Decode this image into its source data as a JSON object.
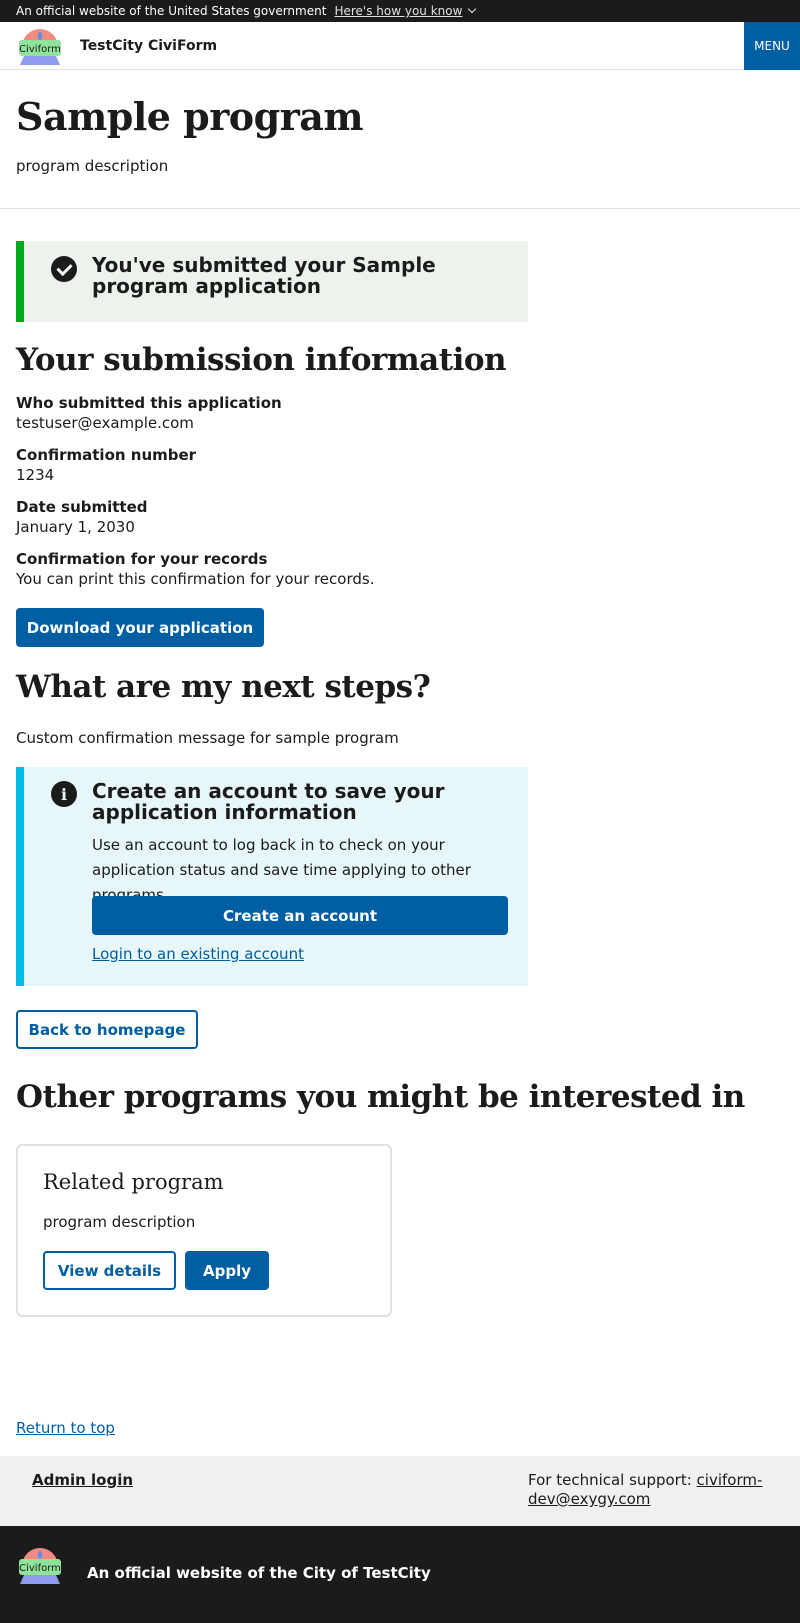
{
  "gov_banner": {
    "text": "An official website of the United States government",
    "link": "Here's how you know"
  },
  "header": {
    "logo_text": "Civiform",
    "site_name": "TestCity CiviForm",
    "menu": "MENU"
  },
  "hero": {
    "title": "Sample program",
    "description": "program description"
  },
  "success_alert": {
    "title": "You've submitted your Sample program application"
  },
  "submission": {
    "heading": "Your submission information",
    "fields": [
      {
        "label": "Who submitted this application",
        "value": "testuser@example.com"
      },
      {
        "label": "Confirmation number",
        "value": "1234"
      },
      {
        "label": "Date submitted",
        "value": "January 1, 2030"
      },
      {
        "label": "Confirmation for your records",
        "value": "You can print this confirmation for your records."
      }
    ],
    "download_label": "Download your application"
  },
  "next_steps": {
    "heading": "What are my next steps?",
    "message": "Custom confirmation message for sample program"
  },
  "account_alert": {
    "title": "Create an account to save your application information",
    "body": "Use an account to log back in to check on your application status and save time applying to other programs.",
    "create_label": "Create an account",
    "login_label": "Login to an existing account"
  },
  "back_label": "Back to homepage",
  "other_programs": {
    "heading": "Other programs you might be interested in",
    "cards": [
      {
        "title": "Related program",
        "description": "program description",
        "view_label": "View details",
        "apply_label": "Apply"
      }
    ]
  },
  "return_top": "Return to top",
  "footer": {
    "admin_login": "Admin login",
    "support_prefix": "For technical support:",
    "support_email": "civiform-dev@exygy.com",
    "official": "An official website of the City of TestCity",
    "logo_text": "Civiform"
  },
  "colors": {
    "primary": "#005ea2",
    "success_border": "#00a91c",
    "success_bg": "#ecf3ec",
    "info_border": "#00bde3",
    "info_bg": "#e7f6f8",
    "banner_bg": "#1b1b1b"
  }
}
